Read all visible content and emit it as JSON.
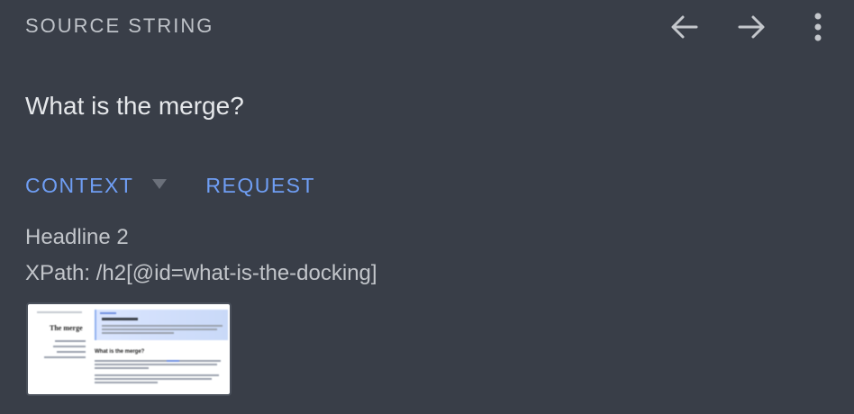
{
  "header": {
    "title": "SOURCE STRING",
    "back_icon": "arrow-left-icon",
    "forward_icon": "arrow-right-icon",
    "menu_icon": "more-vertical-icon"
  },
  "source": {
    "text": "What is the merge?"
  },
  "tabs": {
    "context_label": "CONTEXT",
    "dropdown_icon": "triangle-down-icon",
    "request_label": "REQUEST"
  },
  "context": {
    "element_type": "Headline 2",
    "xpath": "XPath: /h2[@id=what-is-the-docking]"
  },
  "screenshot": {
    "page_title": "The merge",
    "section_heading": "What is the merge?"
  },
  "colors": {
    "background": "#393e48",
    "accent": "#6f9ef4",
    "text_primary": "#e6e8eb",
    "text_secondary": "#c2c5ca"
  }
}
